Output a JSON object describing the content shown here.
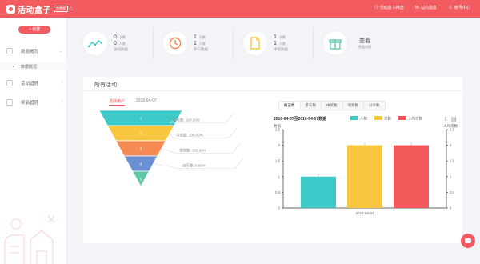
{
  "brand": {
    "logo_text": "活动盒子",
    "badge": "免费版"
  },
  "colors": {
    "accent": "#f25b5f",
    "teal": "#3ec9c9",
    "yellow": "#f9c63f",
    "red": "#f2575a",
    "orange": "#f58b53",
    "blue": "#6a8fd2",
    "green": "#5ec7a8"
  },
  "topbar": {
    "home_icon": "home-icon",
    "links": [
      {
        "icon": "link-icon",
        "label": "活动盒子精选"
      },
      {
        "icon": "mail-icon",
        "label": "站内消息"
      },
      {
        "icon": "user-icon",
        "label": "帐号中心"
      }
    ]
  },
  "sidebar": {
    "create_label": "+ 创建",
    "items": [
      {
        "icon": "grid-icon",
        "label": "数据概况",
        "arrow": "⌄"
      },
      {
        "icon": "flag-icon",
        "label": "活动管理",
        "arrow": "›"
      },
      {
        "icon": "gift-icon",
        "label": "奖品管理",
        "arrow": "›"
      }
    ],
    "sub_item": "数据概况"
  },
  "stats": [
    {
      "icon": "trend-icon",
      "lines": [
        {
          "num": "0",
          "unit": "次数"
        },
        {
          "num": "0",
          "unit": "人数"
        }
      ],
      "label": "访问数据"
    },
    {
      "icon": "clock-icon",
      "lines": [
        {
          "num": "1",
          "unit": "次数"
        },
        {
          "num": "1",
          "unit": "人数"
        }
      ],
      "label": "参与数据"
    },
    {
      "icon": "file-icon",
      "lines": [
        {
          "num": "1",
          "unit": "次数"
        },
        {
          "num": "1",
          "unit": "人数"
        }
      ],
      "label": "中奖数据"
    },
    {
      "icon": "gift-box-icon",
      "more_main": "查看",
      "more_sub": "数据详情"
    }
  ],
  "panel": {
    "title": "所有活动",
    "funnel_tabs": [
      "活跃用户",
      "2016-04-07"
    ],
    "funnel": {
      "levels": [
        {
          "index": "1",
          "label": "参与数: 100.00%",
          "color": "#3ec9c9"
        },
        {
          "index": "2",
          "label": "中奖数: 100.00%",
          "color": "#f9c63f"
        },
        {
          "index": "3",
          "label": "领奖数: 100.00%",
          "color": "#f58b53"
        },
        {
          "index": "4",
          "label": "分享数: 0.00%",
          "color": "#6a8fd2"
        },
        {
          "index": "5",
          "label": "",
          "color": "#5ec7a8"
        }
      ]
    },
    "chart_tabs": [
      "概览数",
      "参与数",
      "中奖数",
      "领奖数",
      "分享数"
    ],
    "chart_tab_active": 0
  },
  "chart_data": {
    "type": "bar",
    "title": "2016-04-07至2016-04-07数据",
    "categories": [
      "2016-04-07"
    ],
    "series": [
      {
        "name": "人数",
        "values": [
          1
        ],
        "color": "#3ec9c9"
      },
      {
        "name": "次数",
        "values": [
          2
        ],
        "color": "#f9c63f"
      },
      {
        "name": "人均次数",
        "values": [
          2
        ],
        "color": "#f2575a"
      }
    ],
    "ylabel_left": "数值",
    "ylabel_right": "人均次数",
    "ylim": [
      0,
      2.5
    ],
    "yticks": [
      "0",
      "0.5",
      "1",
      "1.5",
      "2",
      "2.5"
    ],
    "yticks_right": [
      "0",
      "0.5",
      "1",
      "1.5",
      "2",
      "2.5"
    ],
    "toolbar_icons": [
      "save-icon",
      "view-icon"
    ],
    "grid": false,
    "legend": "top"
  }
}
